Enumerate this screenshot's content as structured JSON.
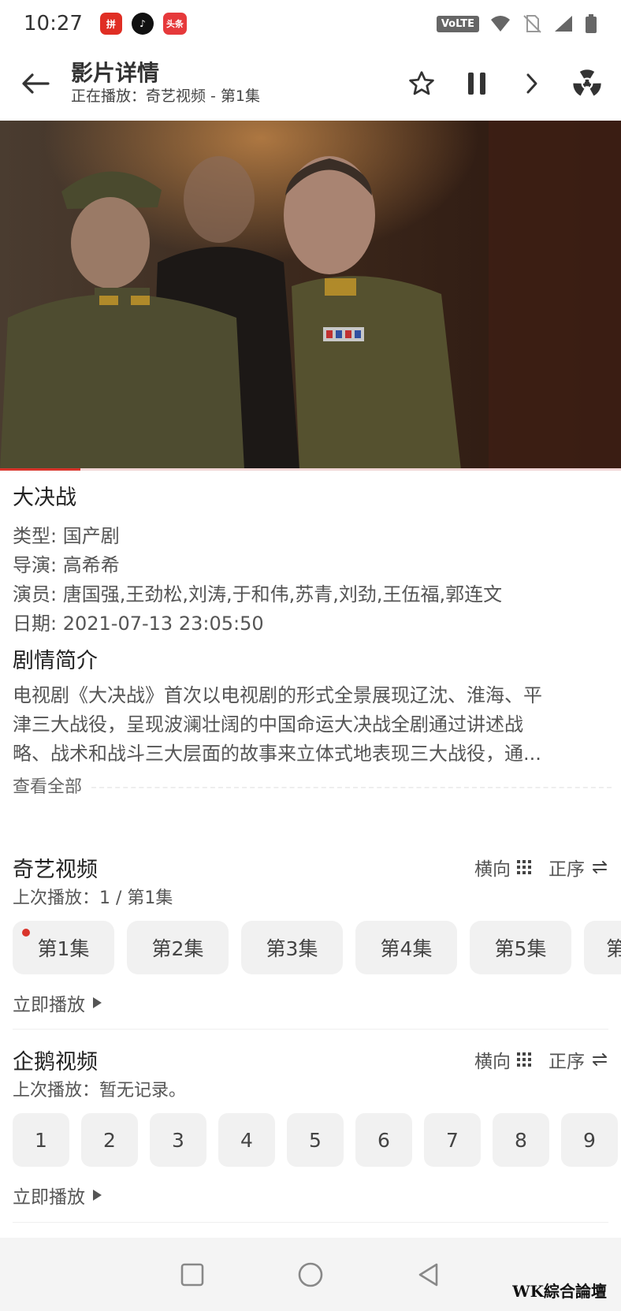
{
  "status_bar": {
    "time": "10:27",
    "notification_apps": [
      {
        "name": "pinduoduo-app-icon",
        "glyph": "拼"
      },
      {
        "name": "tiktok-app-icon",
        "glyph": "♪"
      },
      {
        "name": "toutiao-app-icon",
        "glyph": "头条"
      }
    ],
    "volte_label": "VoLTE"
  },
  "app_bar": {
    "title": "影片详情",
    "subtitle": "正在播放：奇艺视频 - 第1集"
  },
  "video": {
    "progress_fraction": 0.13
  },
  "show": {
    "title": "大决战",
    "genre": "类型: 国产剧",
    "director": "导演: 高希希",
    "cast": "演员: 唐国强,王劲松,刘涛,于和伟,苏青,刘劲,王伍福,郭连文",
    "date": "日期: 2021-07-13 23:05:50",
    "synopsis_heading": "剧情简介",
    "synopsis_lines": [
      "电视剧《大决战》首次以电视剧的形式全景展现辽沈、淮海、平",
      "津三大战役，呈现波澜壮阔的中国命运大决战全剧通过讲述战",
      "略、战术和战斗三大层面的故事来立体式地表现三大战役，通..."
    ],
    "view_all": "查看全部"
  },
  "sources": [
    {
      "name": "奇艺视频",
      "orientation_label": "横向",
      "order_label": "正序",
      "last_played": "上次播放：1 / 第1集",
      "episodes": [
        "第1集",
        "第2集",
        "第3集",
        "第4集",
        "第5集",
        "第"
      ],
      "play_now": "立即播放"
    },
    {
      "name": "企鹅视频",
      "orientation_label": "横向",
      "order_label": "正序",
      "last_played": "上次播放：暂无记录。",
      "episodes": [
        "1",
        "2",
        "3",
        "4",
        "5",
        "6",
        "7",
        "8",
        "9"
      ],
      "play_now": "立即播放"
    }
  ],
  "watermark": "WK綜合論壇",
  "colors": {
    "accent": "#d9342b",
    "chip_bg": "#f1f1f1",
    "nav_bg": "#f4f4f4"
  }
}
